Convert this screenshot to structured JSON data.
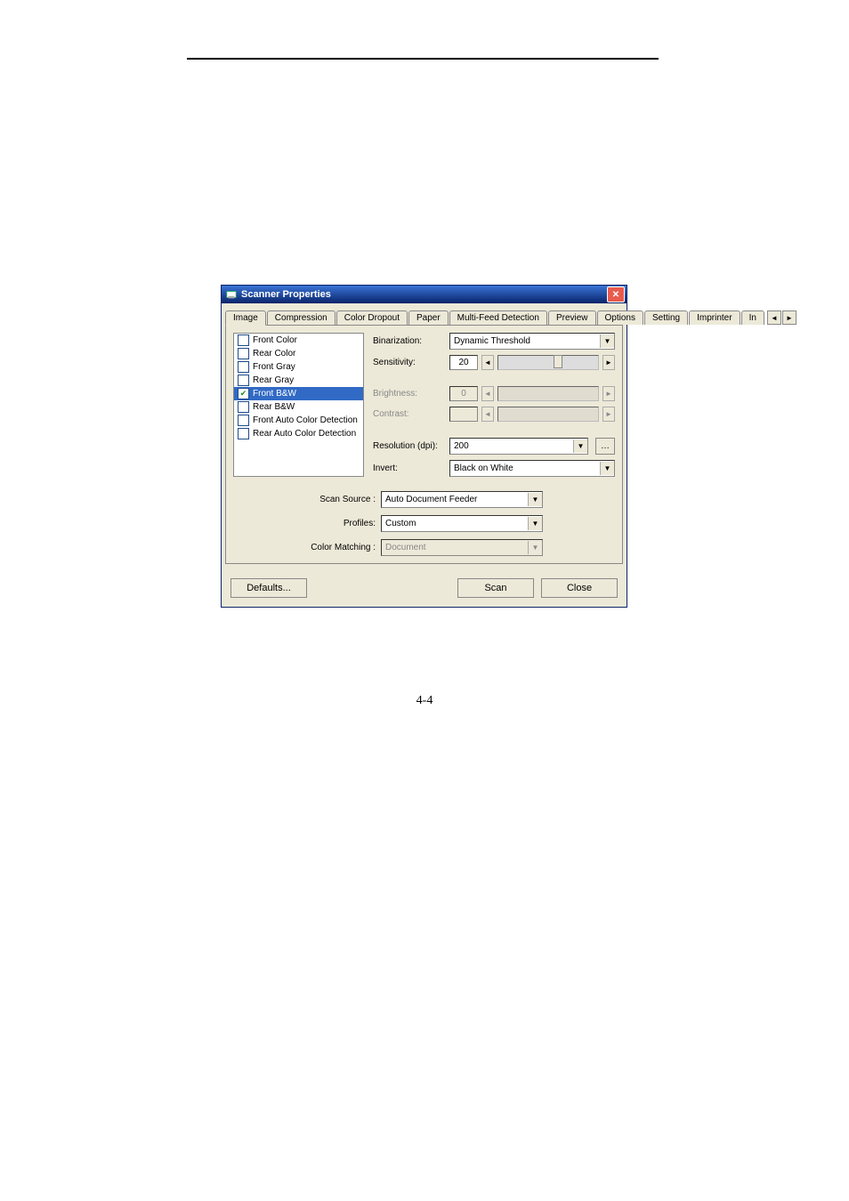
{
  "page_number": "4-4",
  "window": {
    "title": "Scanner Properties"
  },
  "tabs": [
    {
      "label": "Image",
      "active": true
    },
    {
      "label": "Compression"
    },
    {
      "label": "Color Dropout"
    },
    {
      "label": "Paper"
    },
    {
      "label": "Multi-Feed Detection"
    },
    {
      "label": "Preview"
    },
    {
      "label": "Options"
    },
    {
      "label": "Setting"
    },
    {
      "label": "Imprinter"
    },
    {
      "label": "In"
    }
  ],
  "image_list": [
    {
      "label": "Front Color",
      "checked": false,
      "selected": false
    },
    {
      "label": "Rear Color",
      "checked": false,
      "selected": false
    },
    {
      "label": "Front Gray",
      "checked": false,
      "selected": false
    },
    {
      "label": "Rear Gray",
      "checked": false,
      "selected": false
    },
    {
      "label": "Front B&W",
      "checked": true,
      "selected": true
    },
    {
      "label": "Rear B&W",
      "checked": false,
      "selected": false
    },
    {
      "label": "Front Auto Color Detection",
      "checked": false,
      "selected": false
    },
    {
      "label": "Rear Auto Color Detection",
      "checked": false,
      "selected": false
    }
  ],
  "settings": {
    "binarization": {
      "label": "Binarization:",
      "value": "Dynamic Threshold"
    },
    "sensitivity": {
      "label": "Sensitivity:",
      "value": "20"
    },
    "brightness": {
      "label": "Brightness:",
      "value": "0"
    },
    "contrast": {
      "label": "Contrast:",
      "value": ""
    },
    "resolution": {
      "label": "Resolution (dpi):",
      "value": "200"
    },
    "invert": {
      "label": "Invert:",
      "value": "Black on White"
    }
  },
  "lower": {
    "scan_source": {
      "label": "Scan Source :",
      "value": "Auto Document Feeder"
    },
    "profiles": {
      "label": "Profiles:",
      "value": "Custom"
    },
    "color_matching": {
      "label": "Color Matching :",
      "value": "Document"
    }
  },
  "buttons": {
    "defaults": "Defaults...",
    "scan": "Scan",
    "close": "Close"
  }
}
